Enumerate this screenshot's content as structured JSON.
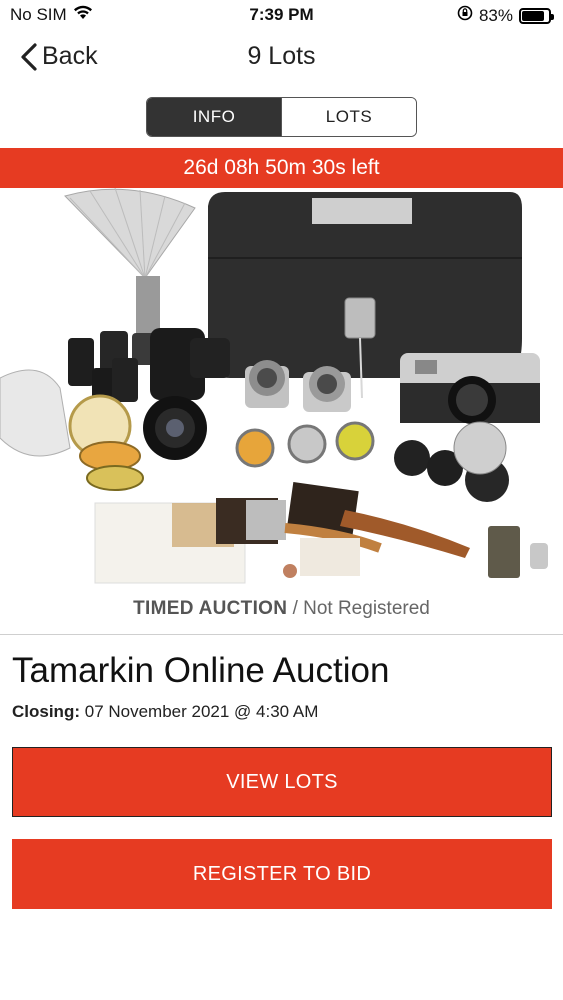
{
  "status_bar": {
    "carrier": "No SIM",
    "time": "7:39 PM",
    "battery_percent": "83%",
    "battery_level": 0.83
  },
  "nav": {
    "back_label": "Back",
    "title": "9 Lots"
  },
  "tabs": [
    {
      "label": "INFO",
      "active": true
    },
    {
      "label": "LOTS",
      "active": false
    }
  ],
  "countdown": "26d 08h 50m 30s left",
  "auction": {
    "type": "TIMED AUCTION",
    "registration": "/ Not Registered",
    "title": "Tamarkin Online Auction",
    "closing_label": "Closing:",
    "closing_value": "07 November 2021 @ 4:30 AM"
  },
  "buttons": {
    "view_lots": "VIEW LOTS",
    "register": "REGISTER TO BID"
  },
  "colors": {
    "accent": "#e63b22",
    "segment_active": "#333333"
  },
  "icons": {
    "back": "chevron-left-icon",
    "wifi": "wifi-icon",
    "lock_rotation": "orientation-lock-icon",
    "battery": "battery-icon"
  }
}
